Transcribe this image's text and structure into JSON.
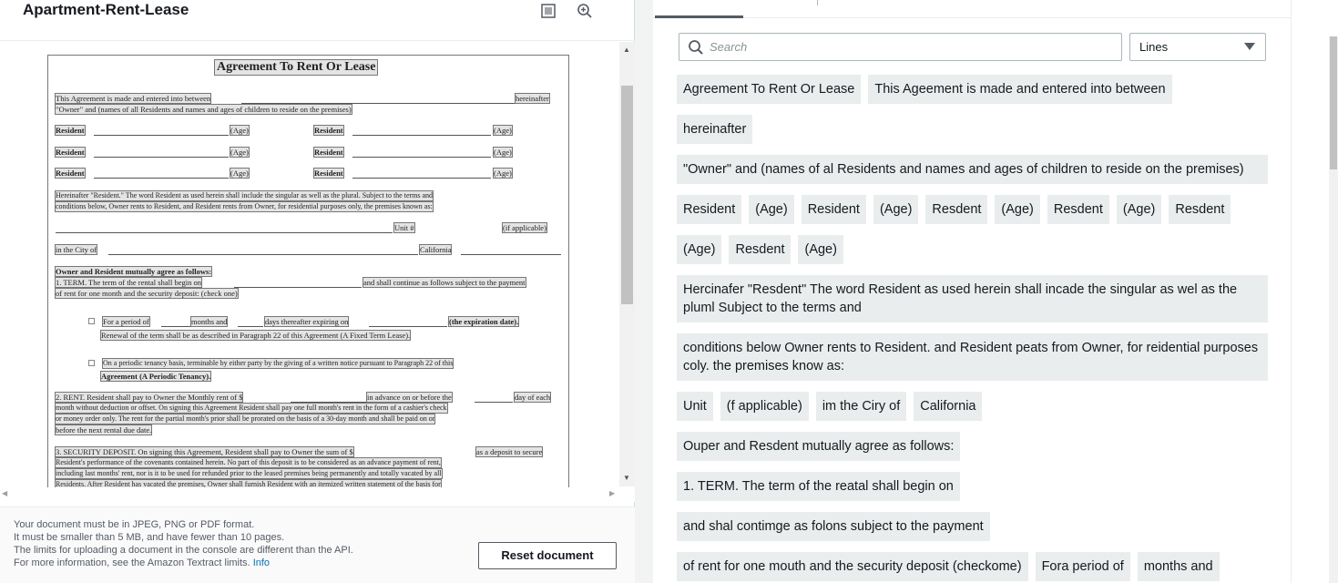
{
  "document": {
    "title": "Apartment-Rent-Lease",
    "page_lines": [
      "Agreement To Rent Or Lease",
      "This Agreement is made and entered into between",
      "hereinafter",
      "\"Owner\" and (names of all Residents and names and ages of children to reside on the premises)",
      "Resident",
      "(Age)",
      "Hereinafter \"Resident.\" The word Resident as used herein shall include the singular as well as the plural. Subject to the terms and",
      "conditions below, Owner rents to Resident, and Resident rents from Owner, for residential purposes only, the premises known as:",
      "Unit #",
      "(if applicable)",
      "in the City of",
      "California",
      "Owner and Resident mutually agree as follows:",
      "1. TERM. The term of the rental shall begin on",
      "and shall continue as follows subject to the payment",
      "of rent for one month and the security deposit: (check one)",
      "For a period of",
      "months and",
      "days thereafter expiring on",
      "(the expiration date).",
      "Renewal of the term shall be as described in Paragraph 22 of this Agreement (A Fixed Term Lease).",
      "On a periodic tenancy basis, terminable by either party by the giving of a written notice pursuant to Paragraph 22 of this",
      "Agreement (A Periodic Tenancy).",
      "2. RENT. Resident shall pay to Owner the Monthly rent of $",
      "in advance on or before the",
      "day of each",
      "month without deduction or offset. On signing this Agreement Resident shall pay one full month's rent in the form of a cashier's check",
      "or money order only. The rent for the partial month's prior shall be prorated on the basis of a 30-day month and shall be paid on or",
      "before the next rental due date.",
      "3. SECURITY DEPOSIT. On signing this Agreement, Resident shall pay to Owner the sum of $",
      "as a deposit to secure",
      "Resident's performance of the covenants contained herein. No part of this deposit is to be considered as an advance payment of rent,",
      "including last months' rent, nor is it to be used for refunded prior to the leased premises being permanently and totally vacated by all",
      "Residents. After Resident has vacated the premises, Owner shall furnish Resident with an itemized written statement of the basis for"
    ]
  },
  "footer": {
    "line1": "Your document must be in JPEG, PNG or PDF format.",
    "line2": "It must be smaller than 5 MB, and have fewer than 10 pages.",
    "line3": "The limits for uploading a document in the console are different than the API.",
    "line4": "For more information, see the Amazon Textract limits.",
    "info_link": "Info",
    "reset_button": "Reset document"
  },
  "results": {
    "search_placeholder": "Search",
    "view_select": "Lines",
    "rows": [
      [
        "Agreement To Rent Or Lease",
        "This Ageement is made and entered into between"
      ],
      [
        "hereinafter"
      ],
      [
        "\"Owner\" and (names of al Residents and names and ages of children to reside on the premises)"
      ],
      [
        "Resident",
        "(Age)",
        "Resident",
        "(Age)",
        "Resdent",
        "(Age)",
        "Resdent",
        "(Age)",
        "Resdent"
      ],
      [
        "(Age)",
        "Resdent",
        "(Age)"
      ],
      [
        "Hercinafer \"Resdent\" The word Resident as used herein shall incade the singular as wel as the pluml Subject to the terms and"
      ],
      [
        "conditions below Owner rents to Resident. and Resident peats from Owner, for reidential purposes coly. the premises know as:"
      ],
      [
        "Unit",
        "(f applicable)",
        "im the Ciry of",
        "California"
      ],
      [
        "Ouper and Resdent mutually agree as follows:"
      ],
      [
        "1. TERM. The term of the reatal shall begin on"
      ],
      [
        "and shal contimge as folons subject to the payment"
      ],
      [
        "of rent for one mouth and the security deposit (checkome)",
        "Fora period of",
        "months and"
      ]
    ]
  },
  "colors": {
    "chip_bg": "#eaeded",
    "link": "#0073bb",
    "border": "#aab7b8"
  },
  "icons": [
    "fit-page-icon",
    "zoom-in-icon",
    "search-icon",
    "caret-down-icon"
  ]
}
